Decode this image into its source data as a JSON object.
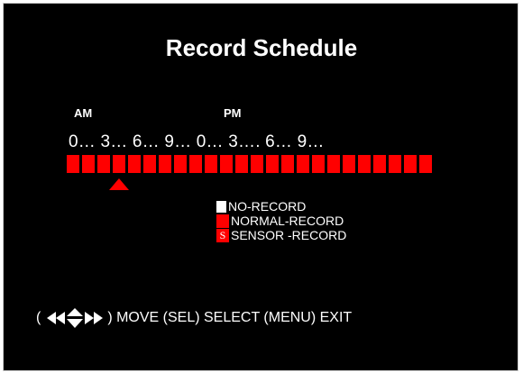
{
  "screen": {
    "title": "Record Schedule"
  },
  "timeline": {
    "am_label": "AM",
    "pm_label": "PM",
    "hour_scale": "0… 3… 6… 9… 0… 3…. 6… 9…",
    "slot_count": 24,
    "slot_modes": [
      "normal",
      "normal",
      "normal",
      "normal",
      "normal",
      "normal",
      "normal",
      "normal",
      "normal",
      "normal",
      "normal",
      "normal",
      "normal",
      "normal",
      "normal",
      "normal",
      "normal",
      "normal",
      "normal",
      "normal",
      "normal",
      "normal",
      "normal",
      "normal"
    ],
    "cursor_slot": 3
  },
  "legend": {
    "items": [
      {
        "label": "NO-RECORD",
        "color": "#ffffff",
        "symbol": ""
      },
      {
        "label": "NORMAL-RECORD",
        "color": "#ff0000",
        "symbol": ""
      },
      {
        "label": "SENSOR -RECORD",
        "color": "#ff0000",
        "symbol": "S"
      }
    ]
  },
  "help_bar": {
    "open_paren": "(",
    "nav_icons": [
      "rewind-left-icon",
      "up-down-icon",
      "fast-forward-right-icon"
    ],
    "text": ") MOVE (SEL) SELECT (MENU) EXIT"
  },
  "colors": {
    "background": "#000000",
    "text": "#ffffff",
    "record": "#ff0000",
    "no_record": "#ffffff"
  }
}
